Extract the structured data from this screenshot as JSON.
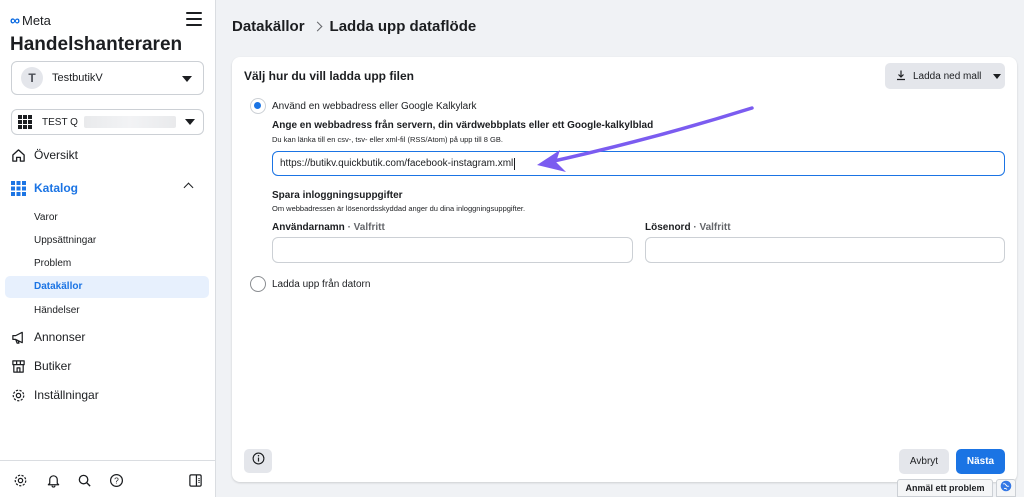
{
  "sidebar": {
    "logo_text": "Meta",
    "app_title": "Handelshanteraren",
    "business": {
      "avatar_letter": "T",
      "name": "TestbutikV"
    },
    "catalog": {
      "name": "TEST Q"
    },
    "nav": {
      "overview": "Översikt",
      "catalog": "Katalog",
      "ads": "Annonser",
      "shops": "Butiker",
      "settings": "Inställningar"
    },
    "catalog_sub": {
      "items": "Varor",
      "sets": "Uppsättningar",
      "problems": "Problem",
      "data_sources": "Datakällor",
      "events": "Händelser"
    }
  },
  "header": {
    "crumb_1": "Datakällor",
    "crumb_2": "Ladda upp dataflöde"
  },
  "card": {
    "title": "Välj hur du vill ladda upp filen",
    "download_template": "Ladda ned mall",
    "option_url": "Använd en webbadress eller Google Kalkylark",
    "url_section_title": "Ange en webbadress från servern, din värdwebbplats eller ett Google-kalkylblad",
    "url_hint": "Du kan länka till en csv-, tsv- eller xml-fil (RSS/Atom) på upp till 8 GB.",
    "url_value": "https://butikv.quickbutik.com/facebook-instagram.xml",
    "login_title": "Spara inloggningsuppgifter",
    "login_hint": "Om webbadressen är lösenordsskyddad anger du dina inloggningsuppgifter.",
    "username_label": "Användarnamn",
    "password_label": "Lösenord",
    "optional_suffix": " · Valfritt",
    "option_upload": "Ladda upp från datorn",
    "cancel": "Avbryt",
    "next": "Nästa"
  },
  "footer": {
    "report_problem": "Anmäl ett problem"
  },
  "colors": {
    "accent": "#1b74e4",
    "annotation_arrow": "#7b5cf0"
  }
}
